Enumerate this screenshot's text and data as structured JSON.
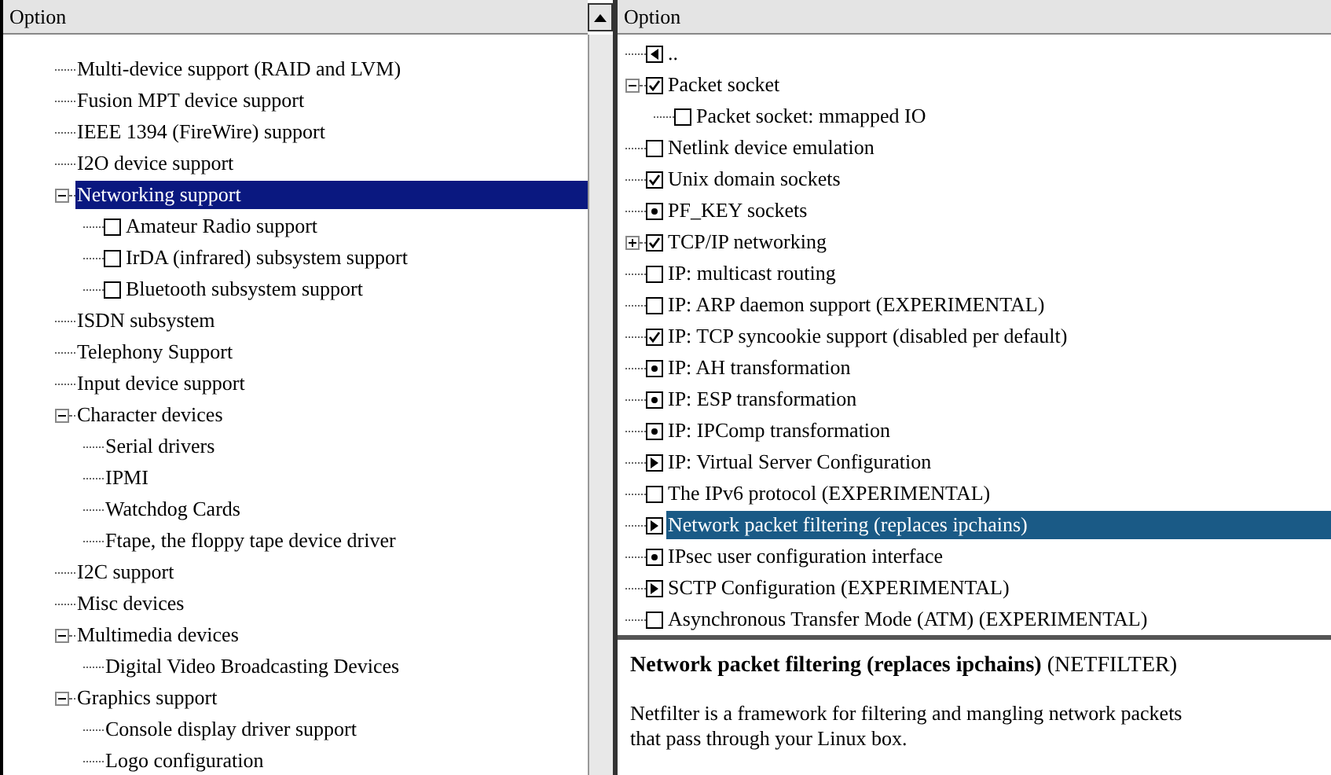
{
  "left_panel": {
    "header": "Option",
    "items": [
      {
        "label": "Multi-device support (RAID and LVM)",
        "selected": false
      },
      {
        "label": "Fusion MPT device support",
        "selected": false
      },
      {
        "label": "IEEE 1394 (FireWire) support",
        "selected": false
      },
      {
        "label": "I2O device support",
        "selected": false
      },
      {
        "label": "Networking support",
        "selected": true,
        "expanded": true,
        "children": [
          {
            "label": "Amateur Radio support",
            "kind": "checkbox",
            "checked": false,
            "selected": false
          },
          {
            "label": "IrDA (infrared) subsystem support",
            "kind": "checkbox",
            "checked": false,
            "selected": false
          },
          {
            "label": "Bluetooth subsystem support",
            "kind": "checkbox",
            "checked": false,
            "selected": false
          }
        ]
      },
      {
        "label": "ISDN subsystem",
        "selected": false
      },
      {
        "label": "Telephony Support",
        "selected": false
      },
      {
        "label": "Input device support",
        "selected": false
      },
      {
        "label": "Character devices",
        "selected": false,
        "expanded": true,
        "children": [
          {
            "label": "Serial drivers",
            "selected": false
          },
          {
            "label": "IPMI",
            "selected": false
          },
          {
            "label": "Watchdog Cards",
            "selected": false
          },
          {
            "label": "Ftape, the floppy tape device driver",
            "selected": false
          }
        ]
      },
      {
        "label": "I2C support",
        "selected": false
      },
      {
        "label": "Misc devices",
        "selected": false
      },
      {
        "label": "Multimedia devices",
        "selected": false,
        "expanded": true,
        "children": [
          {
            "label": "Digital Video Broadcasting Devices",
            "selected": false
          }
        ]
      },
      {
        "label": "Graphics support",
        "selected": false,
        "expanded": true,
        "children": [
          {
            "label": "Console display driver support",
            "selected": false
          },
          {
            "label": "Logo configuration",
            "selected": false
          }
        ]
      }
    ]
  },
  "right_panel": {
    "header": "Option",
    "items": [
      {
        "label": "..",
        "kind": "back",
        "selected": false
      },
      {
        "label": "Packet socket",
        "kind": "checkbox",
        "checked": true,
        "selected": false,
        "expanded": true,
        "children": [
          {
            "label": "Packet socket: mmapped IO",
            "kind": "checkbox",
            "checked": false,
            "selected": false
          }
        ]
      },
      {
        "label": "Netlink device emulation",
        "kind": "checkbox",
        "checked": false,
        "selected": false
      },
      {
        "label": "Unix domain sockets",
        "kind": "checkbox",
        "checked": true,
        "selected": false
      },
      {
        "label": "PF_KEY sockets",
        "kind": "module",
        "selected": false
      },
      {
        "label": "TCP/IP networking",
        "kind": "checkbox",
        "checked": true,
        "selected": false,
        "expanded": false
      },
      {
        "label": "IP: multicast routing",
        "kind": "checkbox",
        "checked": false,
        "selected": false
      },
      {
        "label": "IP: ARP daemon support (EXPERIMENTAL)",
        "kind": "checkbox",
        "checked": false,
        "selected": false
      },
      {
        "label": "IP: TCP syncookie support (disabled per default)",
        "kind": "checkbox",
        "checked": true,
        "selected": false
      },
      {
        "label": "IP: AH transformation",
        "kind": "module",
        "selected": false
      },
      {
        "label": "IP: ESP transformation",
        "kind": "module",
        "selected": false
      },
      {
        "label": "IP: IPComp transformation",
        "kind": "module",
        "selected": false
      },
      {
        "label": "IP: Virtual Server Configuration",
        "kind": "menu",
        "selected": false
      },
      {
        "label": "The IPv6 protocol (EXPERIMENTAL)",
        "kind": "checkbox",
        "checked": false,
        "selected": false
      },
      {
        "label": "Network packet filtering (replaces ipchains)",
        "kind": "menu",
        "selected": true
      },
      {
        "label": "IPsec user configuration interface",
        "kind": "module",
        "selected": false
      },
      {
        "label": "SCTP Configuration (EXPERIMENTAL)",
        "kind": "menu",
        "selected": false
      },
      {
        "label": "Asynchronous Transfer Mode (ATM) (EXPERIMENTAL)",
        "kind": "checkbox",
        "checked": false,
        "selected": false
      }
    ]
  },
  "help": {
    "title": "**Network packet filtering (replaces ipchains)** (NETFILTER)",
    "text": "Netfilter is a framework for filtering and mangling network packets that pass through your Linux box."
  }
}
